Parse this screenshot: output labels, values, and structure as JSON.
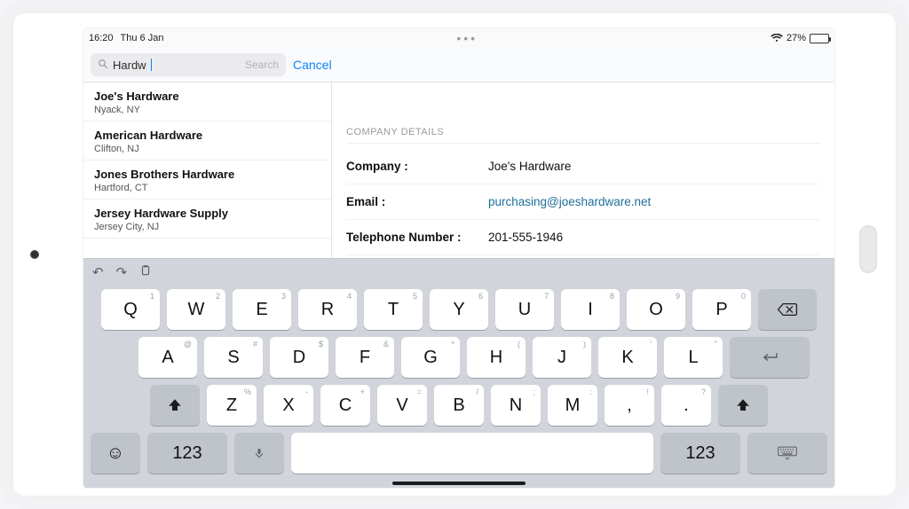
{
  "status": {
    "time": "16:20",
    "date": "Thu 6 Jan",
    "battery": "27%"
  },
  "search": {
    "value": "Hardw",
    "placeholder": "Search",
    "cancel": "Cancel"
  },
  "sidebar": {
    "items": [
      {
        "title": "Joe's Hardware",
        "sub": "Nyack, NY"
      },
      {
        "title": "American Hardware",
        "sub": "Clifton, NJ"
      },
      {
        "title": "Jones Brothers Hardware",
        "sub": "Hartford, CT"
      },
      {
        "title": "Jersey Hardware Supply",
        "sub": "Jersey City, NJ"
      }
    ]
  },
  "detail": {
    "section": "COMPANY DETAILS",
    "company_label": "Company :",
    "company_value": "Joe's Hardware",
    "email_label": "Email :",
    "email_value": "purchasing@joeshardware.net",
    "phone_label": "Telephone Number :",
    "phone_value": "201-555-1946"
  },
  "kbd": {
    "row1": [
      {
        "l": "Q",
        "h": "1"
      },
      {
        "l": "W",
        "h": "2"
      },
      {
        "l": "E",
        "h": "3"
      },
      {
        "l": "R",
        "h": "4"
      },
      {
        "l": "T",
        "h": "5"
      },
      {
        "l": "Y",
        "h": "6"
      },
      {
        "l": "U",
        "h": "7"
      },
      {
        "l": "I",
        "h": "8"
      },
      {
        "l": "O",
        "h": "9"
      },
      {
        "l": "P",
        "h": "0"
      }
    ],
    "row2": [
      {
        "l": "A",
        "h": "@"
      },
      {
        "l": "S",
        "h": "#"
      },
      {
        "l": "D",
        "h": "$"
      },
      {
        "l": "F",
        "h": "&"
      },
      {
        "l": "G",
        "h": "*"
      },
      {
        "l": "H",
        "h": "("
      },
      {
        "l": "J",
        "h": ")"
      },
      {
        "l": "K",
        "h": "'"
      },
      {
        "l": "L",
        "h": "\""
      }
    ],
    "row3": [
      {
        "l": "Z",
        "h": "%"
      },
      {
        "l": "X",
        "h": "-"
      },
      {
        "l": "C",
        "h": "+"
      },
      {
        "l": "V",
        "h": "="
      },
      {
        "l": "B",
        "h": "/"
      },
      {
        "l": "N",
        "h": ";"
      },
      {
        "l": "M",
        "h": ":"
      },
      {
        "l": ",",
        "h": "!"
      },
      {
        "l": ".",
        "h": "?"
      }
    ],
    "num": "123"
  }
}
